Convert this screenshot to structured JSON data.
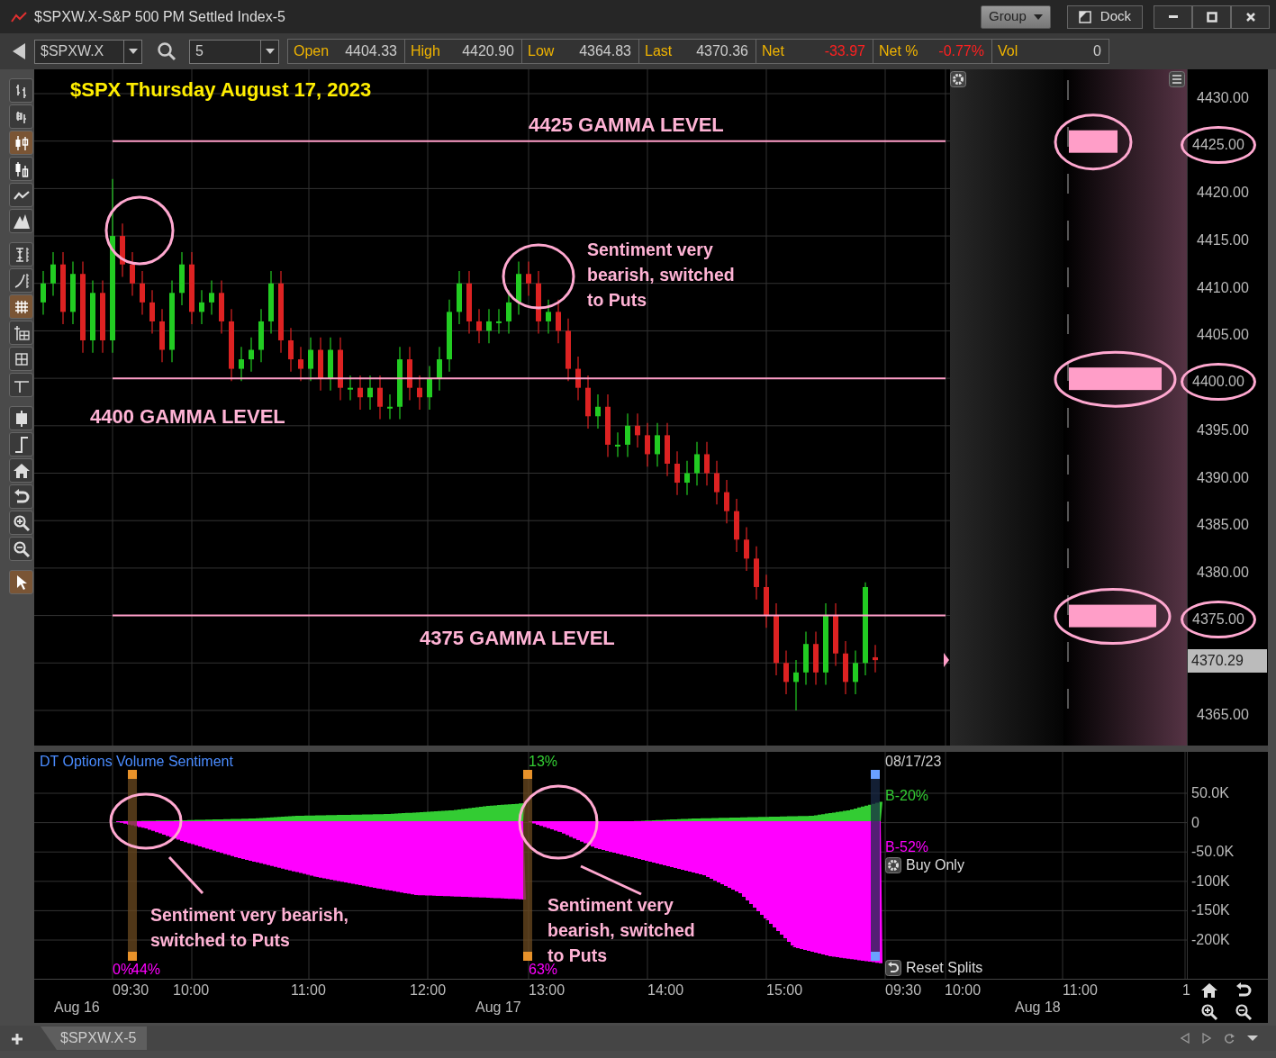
{
  "window": {
    "title": "$SPXW.X-S&P 500 PM Settled Index-5",
    "buttons": [
      "Group",
      "Dock"
    ]
  },
  "toolbar": {
    "symbol": "$SPXW.X",
    "interval": "5",
    "quote": [
      {
        "label": "Open",
        "value": "4404.33",
        "down": false
      },
      {
        "label": "High",
        "value": "4420.90",
        "down": false
      },
      {
        "label": "Low",
        "value": "4364.83",
        "down": false
      },
      {
        "label": "Last",
        "value": "4370.36",
        "down": false
      },
      {
        "label": "Net",
        "value": "-33.97",
        "down": true
      },
      {
        "label": "Net %",
        "value": "-0.77%",
        "down": true
      },
      {
        "label": "Vol",
        "value": "0",
        "down": false
      }
    ]
  },
  "tools": [
    {
      "kind": "ohlc",
      "selected": false
    },
    {
      "kind": "hlc",
      "selected": false
    },
    {
      "kind": "candle",
      "selected": true
    },
    {
      "kind": "hollow",
      "selected": false
    },
    {
      "kind": "line",
      "selected": false
    },
    {
      "kind": "mountain",
      "selected": false
    },
    {
      "kind": "autoscale",
      "selected": false
    },
    {
      "kind": "logscale",
      "selected": false
    },
    {
      "kind": "grid",
      "selected": true
    },
    {
      "kind": "axisgrid",
      "selected": false
    },
    {
      "kind": "tablegrid",
      "selected": false
    },
    {
      "kind": "crosshair",
      "selected": false
    },
    {
      "kind": "databox",
      "selected": false
    },
    {
      "kind": "step",
      "selected": false
    },
    {
      "kind": "home",
      "selected": false
    },
    {
      "kind": "undo",
      "selected": false
    },
    {
      "kind": "zoomin",
      "selected": false
    },
    {
      "kind": "zoomout",
      "selected": false
    },
    {
      "kind": "pointer",
      "selected": true
    }
  ],
  "price_chart": {
    "title": "$SPX Thursday August 17, 2023",
    "ticks": [
      {
        "label": "4430.00",
        "circled": false
      },
      {
        "label": "4425.00",
        "circled": true
      },
      {
        "label": "4420.00",
        "circled": false
      },
      {
        "label": "4415.00",
        "circled": false
      },
      {
        "label": "4410.00",
        "circled": false
      },
      {
        "label": "4405.00",
        "circled": false
      },
      {
        "label": "4400.00",
        "circled": true
      },
      {
        "label": "4395.00",
        "circled": false
      },
      {
        "label": "4390.00",
        "circled": false
      },
      {
        "label": "4385.00",
        "circled": false
      },
      {
        "label": "4380.00",
        "circled": false
      },
      {
        "label": "4375.00",
        "circled": true
      },
      {
        "label": "4370.29",
        "kind": "last"
      },
      {
        "label": "4365.00",
        "circled": false
      }
    ],
    "gamma_labels": [
      "4425 GAMMA LEVEL",
      "4400 GAMMA LEVEL",
      "4375 GAMMA LEVEL"
    ],
    "note": [
      "Sentiment very",
      "bearish, switched",
      "to Puts"
    ]
  },
  "sentiment": {
    "title": "DT Options Volume Sentiment",
    "date": "08/17/23",
    "split_labels": [
      {
        "text": "0%",
        "color": "#ff00ff"
      },
      {
        "text": "44%",
        "color": "#ff00ff"
      },
      {
        "text": "13%",
        "color": "#33cc33"
      },
      {
        "text": "63%",
        "color": "#ff00ff"
      }
    ],
    "legend": [
      {
        "text": "B-20%",
        "color": "#33cc33"
      },
      {
        "text": "B-52%",
        "color": "#ff00ff"
      }
    ],
    "buttons": [
      {
        "label": "Buy Only",
        "kind": "settings"
      },
      {
        "label": "Reset Splits",
        "kind": "reset"
      }
    ],
    "axis": [
      "50.0K",
      "0",
      "-50.0K",
      "-100K",
      "-150K",
      "-200K"
    ],
    "notes": [
      [
        "Sentiment very bearish,",
        "switched to Puts"
      ],
      [
        "Sentiment very",
        "bearish, switched",
        "to Puts"
      ]
    ]
  },
  "time_axis": {
    "times": [
      "09:30",
      "10:00",
      "11:00",
      "12:00",
      "13:00",
      "14:00",
      "15:00",
      "09:30",
      "10:00",
      "11:00",
      "1"
    ],
    "dates": [
      "Aug 16",
      "Aug 17",
      "Aug 18"
    ]
  },
  "tabs": [
    {
      "label": "$SPXW.X-5",
      "selected": true
    }
  ]
}
